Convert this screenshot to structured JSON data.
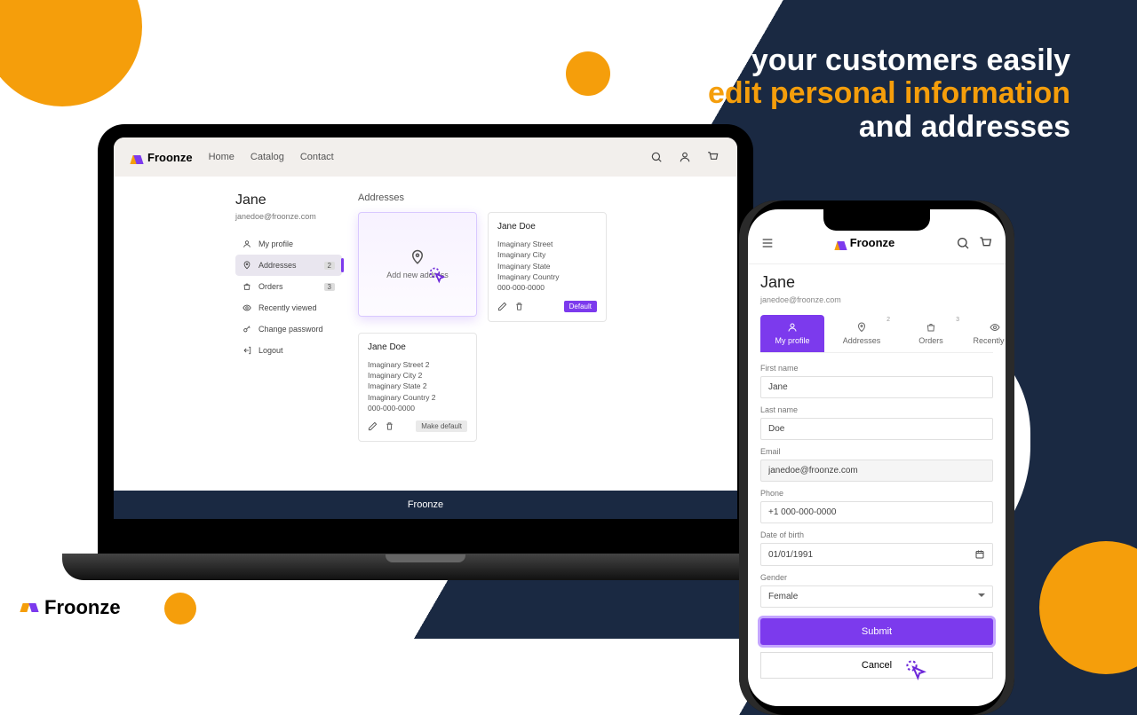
{
  "brand": "Froonze",
  "headline": {
    "line1": "Let your customers easily",
    "line2": "edit personal information",
    "line3": "and addresses"
  },
  "laptop": {
    "nav": {
      "home": "Home",
      "catalog": "Catalog",
      "contact": "Contact"
    },
    "user": {
      "name": "Jane",
      "email": "janedoe@froonze.com"
    },
    "sidebar": {
      "profile": "My profile",
      "addresses": {
        "label": "Addresses",
        "count": "2"
      },
      "orders": {
        "label": "Orders",
        "count": "3"
      },
      "recent": "Recently viewed",
      "change_pw": "Change password",
      "logout": "Logout"
    },
    "section_title": "Addresses",
    "add_new": "Add new address",
    "address1": {
      "name": "Jane Doe",
      "street": "Imaginary Street",
      "city": "Imaginary City",
      "state": "Imaginary State",
      "country": "Imaginary Country",
      "phone": "000-000-0000",
      "default_tag": "Default"
    },
    "address2": {
      "name": "Jane Doe",
      "street": "Imaginary Street 2",
      "city": "Imaginary City 2",
      "state": "Imaginary State 2",
      "country": "Imaginary Country 2",
      "phone": "000-000-0000",
      "make_default": "Make default"
    },
    "footer": "Froonze"
  },
  "phone": {
    "user": {
      "name": "Jane",
      "email": "janedoe@froonze.com"
    },
    "tabs": {
      "profile": "My profile",
      "addresses": {
        "label": "Addresses",
        "count": "2"
      },
      "orders": {
        "label": "Orders",
        "count": "3"
      },
      "recent": "Recently vie"
    },
    "form": {
      "first_name": {
        "label": "First name",
        "value": "Jane"
      },
      "last_name": {
        "label": "Last name",
        "value": "Doe"
      },
      "email": {
        "label": "Email",
        "value": "janedoe@froonze.com"
      },
      "phone": {
        "label": "Phone",
        "value": "+1 000-000-0000"
      },
      "dob": {
        "label": "Date of birth",
        "value": "01/01/1991"
      },
      "gender": {
        "label": "Gender",
        "value": "Female"
      },
      "submit": "Submit",
      "cancel": "Cancel"
    }
  }
}
